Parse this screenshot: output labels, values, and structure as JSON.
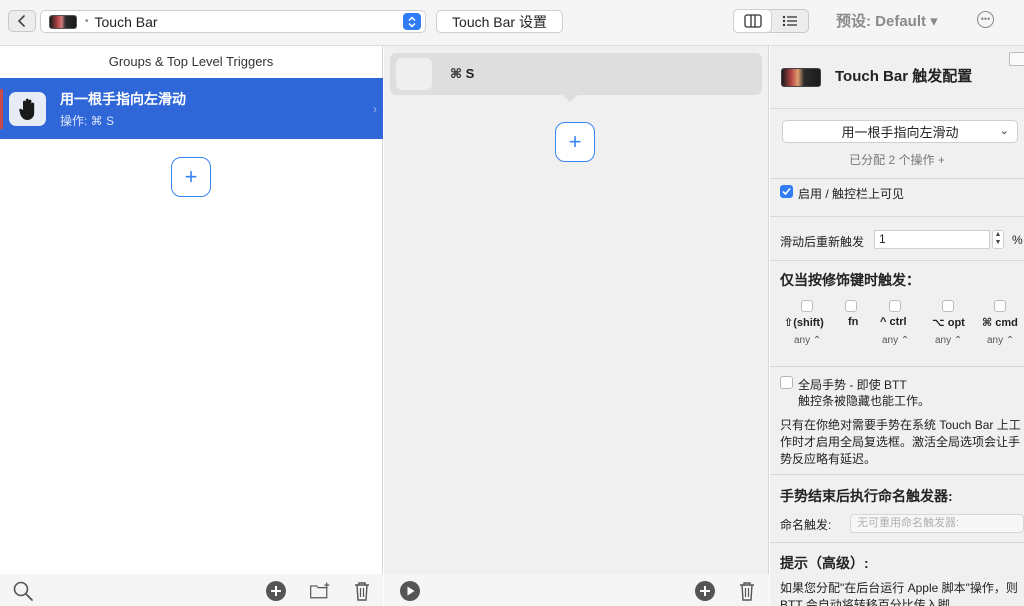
{
  "toolbar": {
    "device_label": "Touch Bar",
    "settings_button": "Touch Bar 设置",
    "preset_label": "预设: Default ▾"
  },
  "left_panel": {
    "header": "Groups & Top Level Triggers",
    "triggers": [
      {
        "title": "用一根手指向左滑动",
        "subtitle": "操作: ⌘ S"
      }
    ],
    "add_symbol": "+"
  },
  "middle_panel": {
    "action_label": "⌘ S",
    "add_symbol": "+"
  },
  "right_panel": {
    "title": "Touch Bar 触发配置",
    "gesture_select": "用一根手指向左滑动",
    "assigned_text": "已分配 2 个操作 +",
    "enable_label": "启用 / 触控栏上可见",
    "enable_checked": true,
    "retrigger_label": "滑动后重新触发",
    "retrigger_value": "1",
    "retrigger_unit": "%",
    "modifiers_heading": "仅当按修饰键时触发：",
    "modifiers": [
      {
        "label": "⇧(shift)",
        "any": "any ⌃"
      },
      {
        "label": "fn",
        "any": ""
      },
      {
        "label": "^ ctrl",
        "any": "any ⌃"
      },
      {
        "label": "⌥ opt",
        "any": "any ⌃"
      },
      {
        "label": "⌘ cmd",
        "any": "any ⌃"
      }
    ],
    "global_gesture_line1": "全局手势 - 即使 BTT",
    "global_gesture_line2": "触控条被隐藏也能工作。",
    "global_note": "只有在你绝对需要手势在系统 Touch Bar 上工作时才启用全局复选框。激活全局选项会让手势反应略有延迟。",
    "named_heading": "手势结束后执行命名触发器:",
    "named_label": "命名触发:",
    "named_placeholder": "无可重用命名触发器:",
    "tips_heading": "提示（高级）:",
    "tips_text": "如果您分配\"在后台运行 Apple 脚本\"操作，则 BTT 会自动将转移百分比传入脚"
  }
}
